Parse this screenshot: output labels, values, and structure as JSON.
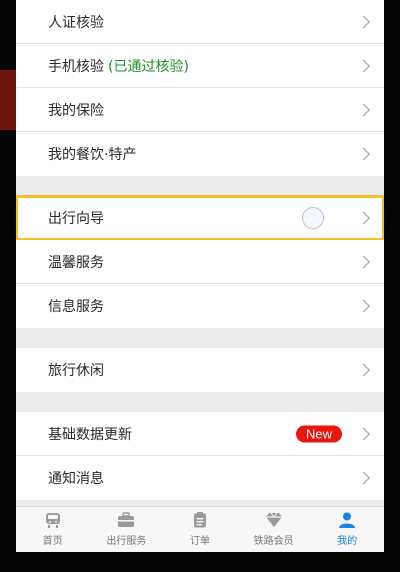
{
  "menu_groups": [
    {
      "items": [
        {
          "label": "人证核验",
          "note": ""
        },
        {
          "label": "手机核验",
          "note": "(已通过核验)"
        },
        {
          "label": "我的保险",
          "note": ""
        },
        {
          "label": "我的餐饮·特产",
          "note": ""
        }
      ]
    },
    {
      "items": [
        {
          "label": "出行向导",
          "highlighted": true
        },
        {
          "label": "温馨服务"
        },
        {
          "label": "信息服务"
        }
      ]
    },
    {
      "items": [
        {
          "label": "旅行休闲"
        }
      ]
    },
    {
      "items": [
        {
          "label": "基础数据更新",
          "badge": "New"
        },
        {
          "label": "通知消息"
        }
      ]
    }
  ],
  "tabbar": {
    "tabs": [
      {
        "label": "首页",
        "icon": "train-icon",
        "active": false
      },
      {
        "label": "出行服务",
        "icon": "briefcase-icon",
        "active": false
      },
      {
        "label": "订单",
        "icon": "clipboard-icon",
        "active": false
      },
      {
        "label": "铁路会员",
        "icon": "diamond-icon",
        "active": false
      },
      {
        "label": "我的",
        "icon": "person-icon",
        "active": true
      }
    ]
  },
  "colors": {
    "highlight_border": "#f3c12b",
    "verified_note": "#1e8f2e",
    "badge_bg": "#e8160c",
    "active_tab": "#1a84e5"
  }
}
